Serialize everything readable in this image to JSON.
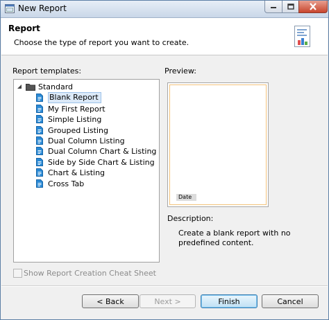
{
  "window": {
    "title": "New Report"
  },
  "header": {
    "title": "Report",
    "subtitle": "Choose the type of report you want to create."
  },
  "templates": {
    "label": "Report templates:",
    "root": "Standard",
    "items": [
      "Blank Report",
      "My First Report",
      "Simple Listing",
      "Grouped Listing",
      "Dual Column Listing",
      "Dual Column Chart & Listing",
      "Side by Side Chart & Listing",
      "Chart & Listing",
      "Cross Tab"
    ],
    "selected": "Blank Report"
  },
  "preview": {
    "label": "Preview:",
    "date_tag": "Date"
  },
  "description": {
    "label": "Description:",
    "text": "Create a blank report with no predefined content."
  },
  "cheat_sheet": {
    "label": "Show Report Creation Cheat Sheet",
    "checked": false,
    "enabled": false
  },
  "buttons": {
    "back": "< Back",
    "next": "Next >",
    "finish": "Finish",
    "cancel": "Cancel"
  }
}
